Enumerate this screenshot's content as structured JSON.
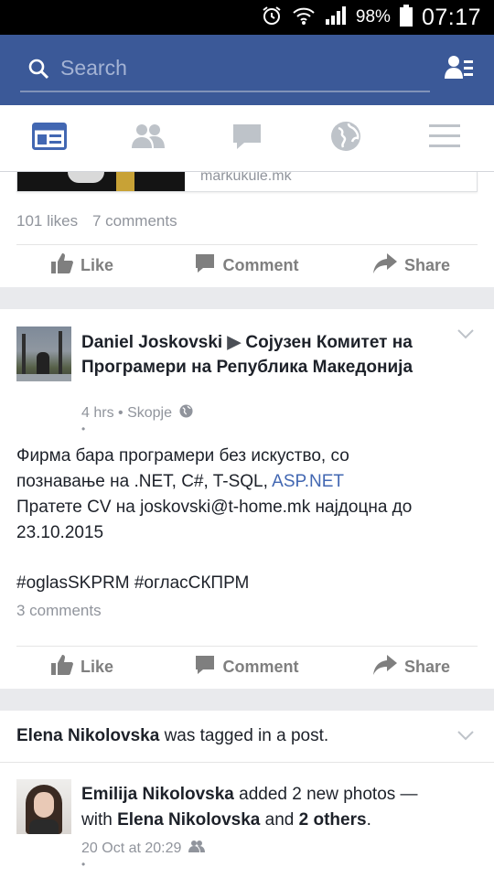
{
  "status_bar": {
    "battery": "98%",
    "time": "07:17"
  },
  "search": {
    "placeholder": "Search"
  },
  "tabs": [
    "news-feed",
    "friends",
    "messages",
    "notifications",
    "menu"
  ],
  "prev_post": {
    "link_domain": "markukule.mk",
    "likes": "101 likes",
    "comments": "7 comments"
  },
  "actions": {
    "like": "Like",
    "comment": "Comment",
    "share": "Share"
  },
  "post": {
    "author": "Daniel Joskovski",
    "arrow": "▶",
    "group": "Сојузен Комитет на Програмери на Република Македонија",
    "time": "4 hrs • Skopje",
    "dot": "•",
    "line1": "Фирма бара програмери без искуство, со",
    "line2_prefix": "познавање на .NET, C#, T-SQL, ",
    "line2_link": "ASP.NET",
    "line3": "Пратете CV на joskovski@t-home.mk најдоцна до",
    "line4": "23.10.2015",
    "hashtags": "#oglasSKPRM #огласСКПРМ",
    "comments": "3 comments"
  },
  "story": {
    "tagged_name": "Elena Nikolovska",
    "tagged_text": " was tagged in a post.",
    "author": "Emilija Nikolovska",
    "added_text": " added 2 new photos —",
    "with_text": "with ",
    "with_name": "Elena Nikolovska",
    "and_text": " and ",
    "others": "2 others",
    "period": ".",
    "time": "20 Oct at 20:29",
    "dot": "•"
  },
  "colors": {
    "brand": "#3b5998",
    "link": "#4267b2",
    "muted": "#90949c"
  }
}
